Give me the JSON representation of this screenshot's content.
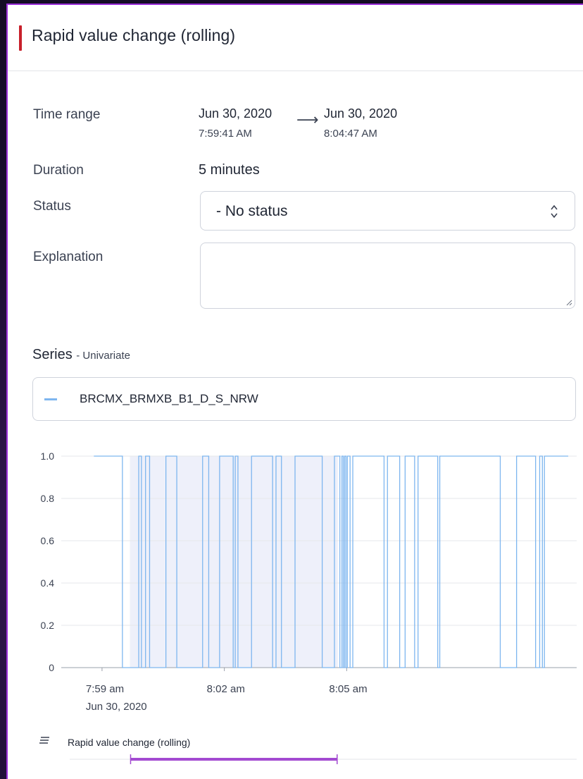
{
  "header": {
    "title": "Rapid value change (rolling)",
    "accent_color": "#c8202b"
  },
  "fields": {
    "time_range_label": "Time range",
    "start_date": "Jun 30, 2020",
    "start_time": "7:59:41 AM",
    "arrow": "⟶",
    "end_date": "Jun 30, 2020",
    "end_time": "8:04:47 AM",
    "duration_label": "Duration",
    "duration_value": "5 minutes",
    "status_label": "Status",
    "status_value": "- No status",
    "explanation_label": "Explanation",
    "explanation_value": ""
  },
  "series": {
    "heading": "Series",
    "subheading": "- Univariate",
    "items": [
      {
        "name": "BRCMX_BRMXB_B1_D_S_NRW",
        "color": "#7eb6ef"
      }
    ]
  },
  "chart_data": {
    "type": "line",
    "step": true,
    "x_unit": "time",
    "series": [
      {
        "name": "BRCMX_BRMXB_B1_D_S_NRW",
        "color": "#7eb6ef",
        "points": [
          [
            "7:58:48",
            1
          ],
          [
            "7:59:30",
            0
          ],
          [
            "7:59:54",
            1
          ],
          [
            "7:59:58",
            0
          ],
          [
            "8:00:04",
            1
          ],
          [
            "8:00:10",
            0
          ],
          [
            "8:00:34",
            1
          ],
          [
            "8:00:50",
            0
          ],
          [
            "8:01:28",
            1
          ],
          [
            "8:01:37",
            0
          ],
          [
            "8:01:53",
            1
          ],
          [
            "8:02:13",
            0
          ],
          [
            "8:02:16",
            1
          ],
          [
            "8:02:20",
            0
          ],
          [
            "8:02:40",
            1
          ],
          [
            "8:03:11",
            0
          ],
          [
            "8:03:16",
            1
          ],
          [
            "8:03:24",
            0
          ],
          [
            "8:03:44",
            1
          ],
          [
            "8:04:24",
            0
          ],
          [
            "8:04:42",
            1
          ],
          [
            "8:04:50",
            0
          ],
          [
            "8:04:53",
            1
          ],
          [
            "8:04:55",
            0
          ],
          [
            "8:04:57",
            1
          ],
          [
            "8:04:59",
            0
          ],
          [
            "8:05:01",
            1
          ],
          [
            "8:05:05",
            0
          ],
          [
            "8:05:09",
            1
          ],
          [
            "8:05:55",
            0
          ],
          [
            "8:06:00",
            1
          ],
          [
            "8:06:18",
            0
          ],
          [
            "8:06:26",
            1
          ],
          [
            "8:06:40",
            0
          ],
          [
            "8:06:45",
            1
          ],
          [
            "8:07:14",
            0
          ],
          [
            "8:07:17",
            1
          ],
          [
            "8:08:46",
            0
          ],
          [
            "8:09:10",
            1
          ],
          [
            "8:09:38",
            0
          ],
          [
            "8:09:44",
            1
          ],
          [
            "8:09:48",
            0
          ],
          [
            "8:09:51",
            1
          ],
          [
            "8:10:26",
            1
          ]
        ]
      }
    ],
    "ylim": [
      0,
      1
    ],
    "y_ticks": [
      "1.0",
      "0.8",
      "0.6",
      "0.4",
      "0.2",
      "0"
    ],
    "x_ticks": [
      {
        "line1": "7:59 am",
        "line2": "Jun 30, 2020"
      },
      {
        "line1": "8:02 am",
        "line2": ""
      },
      {
        "line1": "8:05 am",
        "line2": ""
      }
    ],
    "highlight": {
      "start": "7:59:41",
      "end": "8:04:47",
      "color": "#eef0fa"
    },
    "grid": true
  },
  "timeline": {
    "label": "Rapid value change (rolling)",
    "start": "7:59:41",
    "end": "8:04:47",
    "color": "#a34ad1"
  }
}
